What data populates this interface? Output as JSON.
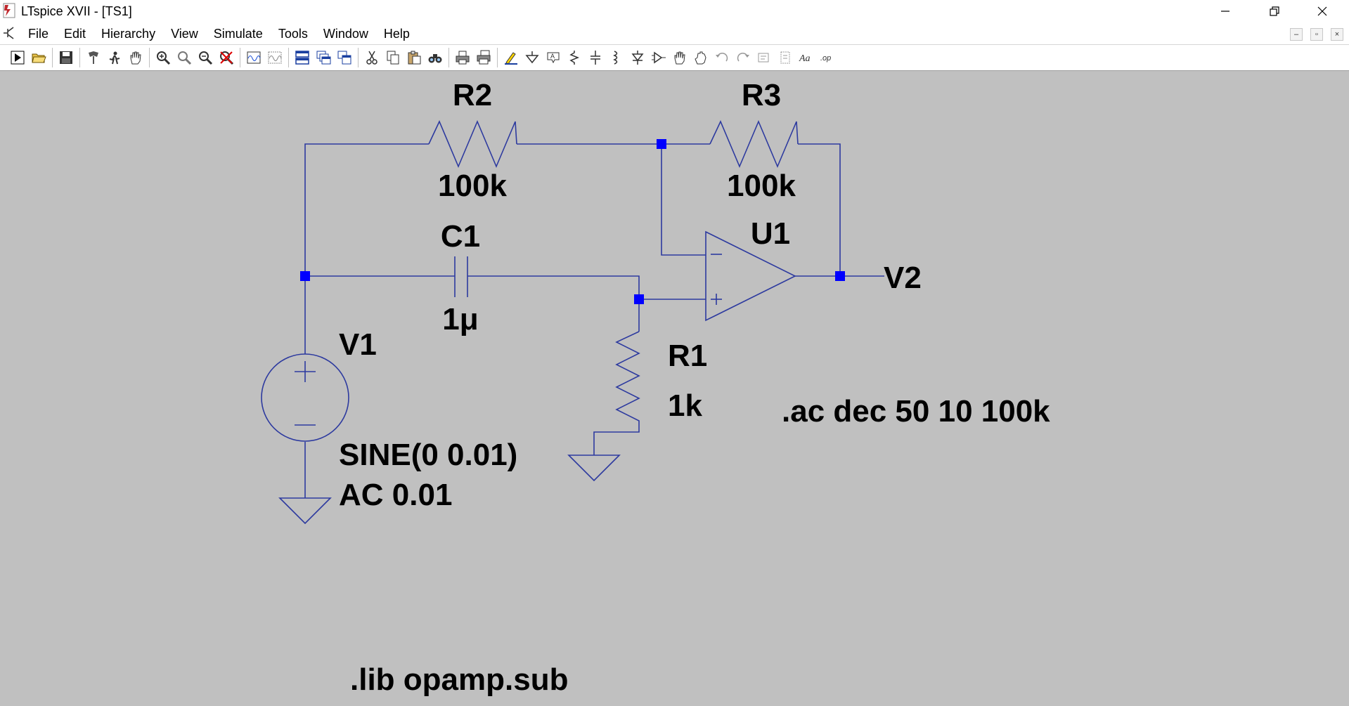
{
  "window": {
    "title": "LTspice XVII - [TS1]",
    "controls": [
      "minimize-icon",
      "restore-icon",
      "close-icon"
    ]
  },
  "menu": {
    "items": [
      "File",
      "Edit",
      "Hierarchy",
      "View",
      "Simulate",
      "Tools",
      "Window",
      "Help"
    ],
    "mdi_controls": [
      "–",
      "▫",
      "×"
    ]
  },
  "toolbar": {
    "icons": [
      "run-icon",
      "open-icon",
      "save-icon",
      "control-panel-icon",
      "halt-icon",
      "pan-icon",
      "zoom-in-icon",
      "zoom-pan-icon",
      "zoom-out-icon",
      "zoom-fit-icon",
      "waveform-icon",
      "waveform-fit-icon",
      "tile-horizontal-icon",
      "cascade-icon",
      "tile-vertical-icon",
      "cut-icon",
      "copy-icon",
      "paste-icon",
      "find-icon",
      "print-icon",
      "print-setup-icon",
      "draw-wire-icon",
      "ground-icon",
      "label-net-icon",
      "resistor-icon",
      "capacitor-icon",
      "inductor-icon",
      "diode-icon",
      "component-icon",
      "move-icon",
      "drag-icon",
      "undo-icon",
      "redo-icon",
      "rotate-icon",
      "mirror-icon",
      "text-icon",
      "spice-directive-icon"
    ]
  },
  "schematic": {
    "components": {
      "R2": {
        "name": "R2",
        "value": "100k"
      },
      "R3": {
        "name": "R3",
        "value": "100k"
      },
      "C1": {
        "name": "C1",
        "value": "1μ"
      },
      "U1": {
        "name": "U1"
      },
      "R1": {
        "name": "R1",
        "value": "1k"
      },
      "V1": {
        "name": "V1",
        "value_line1": "SINE(0 0.01)",
        "value_line2": "AC 0.01"
      }
    },
    "net_labels": {
      "output": "V2"
    },
    "directives": {
      "analysis": ".ac dec 50 10 100k",
      "library": ".lib opamp.sub"
    },
    "colors": {
      "wire": "#2d3a9f",
      "junction": "#0000ff",
      "background": "#c0c0c0"
    }
  }
}
